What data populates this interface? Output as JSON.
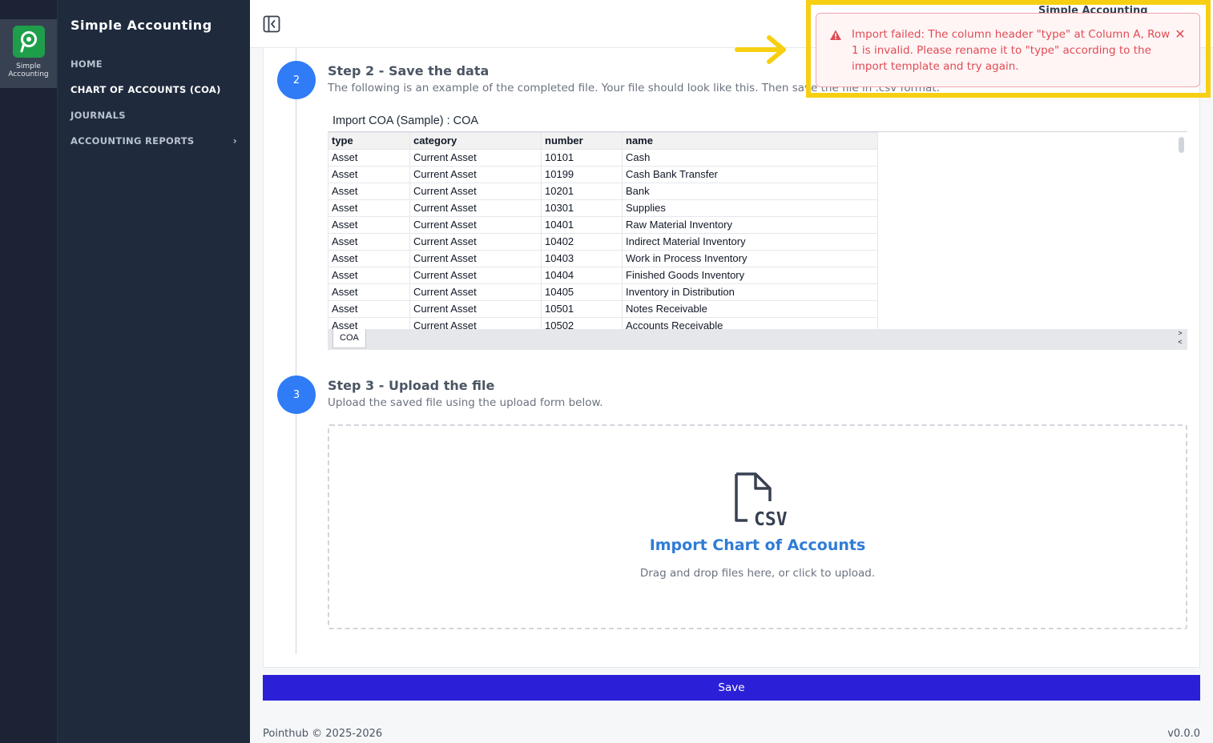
{
  "rail": {
    "app_label": "Simple Accounting",
    "logo_icon": "pointhub-p-logo"
  },
  "sidebar": {
    "title": "Simple Accounting",
    "items": [
      {
        "label": "HOME",
        "active": false
      },
      {
        "label": "CHART OF ACCOUNTS (COA)",
        "active": true
      },
      {
        "label": "JOURNALS",
        "active": false
      },
      {
        "label": "ACCOUNTING REPORTS",
        "active": false,
        "chevron": "›"
      }
    ]
  },
  "topbar": {
    "collapse_icon": "sidebar-collapse-icon",
    "user_name": "Simple Accounting"
  },
  "steps": {
    "step2": {
      "number": "2",
      "title": "Step 2 - Save the data",
      "description": "The following is an example of the completed file. Your file should look like this. Then save the file in .csv format."
    },
    "step3": {
      "number": "3",
      "title": "Step 3 - Upload the file",
      "description": "Upload the saved file using the upload form below."
    }
  },
  "sheet": {
    "caption": "Import COA (Sample) : COA",
    "columns": [
      "type",
      "category",
      "number",
      "name"
    ],
    "rows": [
      [
        "Asset",
        "Current Asset",
        "10101",
        "Cash"
      ],
      [
        "Asset",
        "Current Asset",
        "10199",
        "Cash Bank Transfer"
      ],
      [
        "Asset",
        "Current Asset",
        "10201",
        "Bank"
      ],
      [
        "Asset",
        "Current Asset",
        "10301",
        "Supplies"
      ],
      [
        "Asset",
        "Current Asset",
        "10401",
        "Raw Material Inventory"
      ],
      [
        "Asset",
        "Current Asset",
        "10402",
        "Indirect Material Inventory"
      ],
      [
        "Asset",
        "Current Asset",
        "10403",
        "Work in Process Inventory"
      ],
      [
        "Asset",
        "Current Asset",
        "10404",
        "Finished Goods Inventory"
      ],
      [
        "Asset",
        "Current Asset",
        "10405",
        "Inventory in Distribution"
      ],
      [
        "Asset",
        "Current Asset",
        "10501",
        "Notes Receivable"
      ],
      [
        "Asset",
        "Current Asset",
        "10502",
        "Accounts Receivable"
      ]
    ],
    "tab_label": "COA",
    "nav_next": ">",
    "nav_prev": "<"
  },
  "upload": {
    "icon": "csv-file-icon",
    "title": "Import Chart of Accounts",
    "subtitle": "Drag and drop files here, or click to upload."
  },
  "save_label": "Save",
  "footer": {
    "copyright": "Pointhub © 2025-2026",
    "version": "v0.0.0"
  },
  "toast": {
    "icon": "warning-triangle-icon",
    "message": "Import failed: The column header \"type\" at Column A, Row 1 is invalid. Please rename it to \"type\" according to the import template and try again.",
    "close": "✕"
  },
  "colors": {
    "accent": "#2f7cf6",
    "primary_button": "#2b20d8",
    "error": "#e04b55",
    "highlight": "#f6cf12",
    "sidebar": "#1f2a3d"
  }
}
